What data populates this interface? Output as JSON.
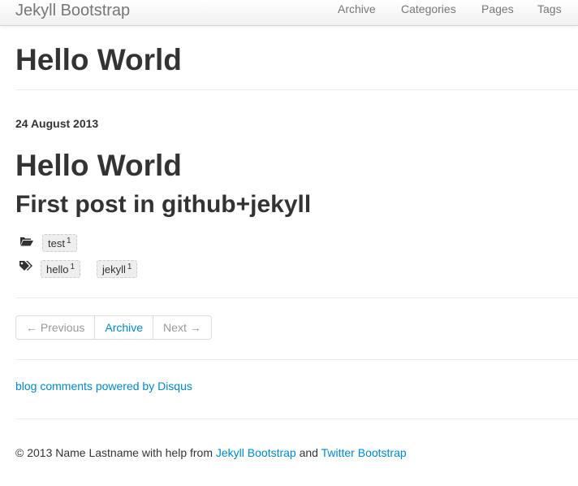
{
  "navbar": {
    "brand": "Jekyll Bootstrap",
    "links": [
      "Archive",
      "Categories",
      "Pages",
      "Tags"
    ]
  },
  "page": {
    "title": "Hello World"
  },
  "post": {
    "date": "24 August 2013",
    "title": "Hello World",
    "subtitle": "First post in github+jekyll",
    "categories": [
      {
        "name": "test",
        "count": "1"
      }
    ],
    "tags": [
      {
        "name": "hello",
        "count": "1"
      },
      {
        "name": "jekyll",
        "count": "1"
      }
    ]
  },
  "pager": {
    "previous": "← Previous",
    "archive": "Archive",
    "next": "Next →"
  },
  "comments": {
    "link": "blog comments powered by Disqus"
  },
  "footer": {
    "prefix": "© 2013 Name Lastname with help from ",
    "jekyll_link": "Jekyll Bootstrap",
    "and": " and ",
    "twitter_link": "Twitter Bootstrap"
  },
  "colors": {
    "link": "#0088cc",
    "text": "#333333",
    "muted": "#777777",
    "disabled": "#999999"
  },
  "icons": {
    "category": "folder-open-icon",
    "tags": "tags-icon"
  }
}
